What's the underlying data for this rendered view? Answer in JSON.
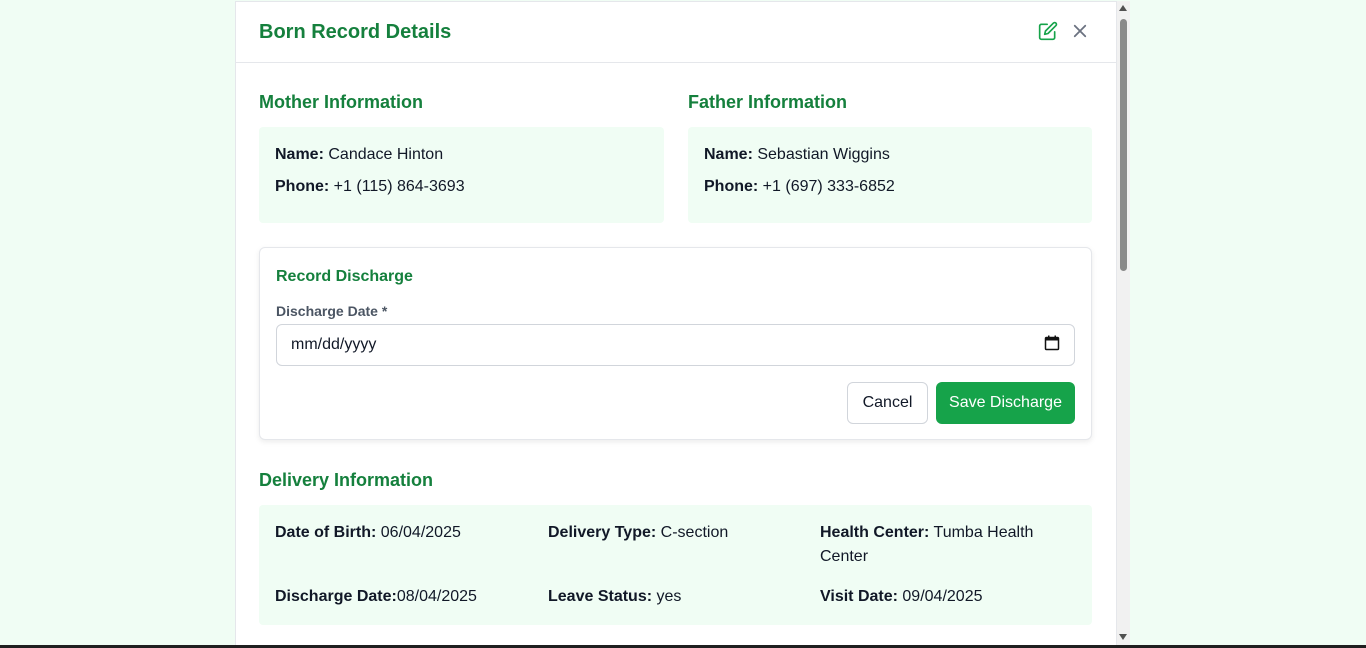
{
  "modal": {
    "title": "Born Record Details",
    "edit_icon": "edit-icon",
    "close_icon": "close-icon"
  },
  "mother": {
    "section_title": "Mother Information",
    "name_label": "Name:",
    "name": "Candace Hinton",
    "phone_label": "Phone:",
    "phone": "+1 (115) 864-3693"
  },
  "father": {
    "section_title": "Father Information",
    "name_label": "Name:",
    "name": "Sebastian Wiggins",
    "phone_label": "Phone:",
    "phone": "+1 (697) 333-6852"
  },
  "discharge": {
    "title": "Record Discharge",
    "date_label": "Discharge Date *",
    "date_placeholder": "mm/dd/yyyy",
    "cancel_label": "Cancel",
    "save_label": "Save Discharge"
  },
  "delivery": {
    "section_title": "Delivery Information",
    "dob_label": "Date of Birth:",
    "dob": "06/04/2025",
    "type_label": "Delivery Type:",
    "type": "C-section",
    "center_label": "Health Center:",
    "center": "Tumba Health Center",
    "discharge_label": "Discharge Date:",
    "discharge_date": "08/04/2025",
    "leave_label": "Leave Status:",
    "leave": "yes",
    "visit_label": "Visit Date:",
    "visit": "09/04/2025"
  },
  "colors": {
    "accent": "#15803d",
    "button": "#16a34a",
    "card_bg": "#f0fdf4"
  }
}
